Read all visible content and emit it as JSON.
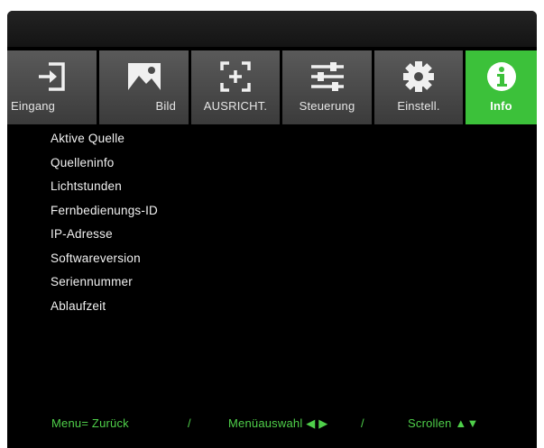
{
  "tabs": [
    {
      "label": "Eingang",
      "icon": "input-arrow-icon",
      "active": false
    },
    {
      "label": "Bild",
      "icon": "image-icon",
      "active": false
    },
    {
      "label": "AUSRICHT.",
      "icon": "alignment-icon",
      "active": false
    },
    {
      "label": "Steuerung",
      "icon": "sliders-icon",
      "active": false
    },
    {
      "label": "Einstell.",
      "icon": "gear-icon",
      "active": false
    },
    {
      "label": "Info",
      "icon": "info-icon",
      "active": true
    }
  ],
  "menu_items": [
    "Aktive Quelle",
    "Quelleninfo",
    "Lichtstunden",
    "Fernbedienungs-ID",
    "IP-Adresse",
    "Softwareversion",
    "Seriennummer",
    "Ablaufzeit"
  ],
  "footer": {
    "back": "Menu= Zurück",
    "sep1": "/",
    "select": "Menüauswahl ◀ ▶",
    "sep2": "/",
    "scroll": "Scrollen ▲▼"
  },
  "colors": {
    "active_tab": "#3cc13a",
    "inactive_tab": "#4a4a4a",
    "footer_text": "#4fd04a",
    "background": "#000000"
  }
}
